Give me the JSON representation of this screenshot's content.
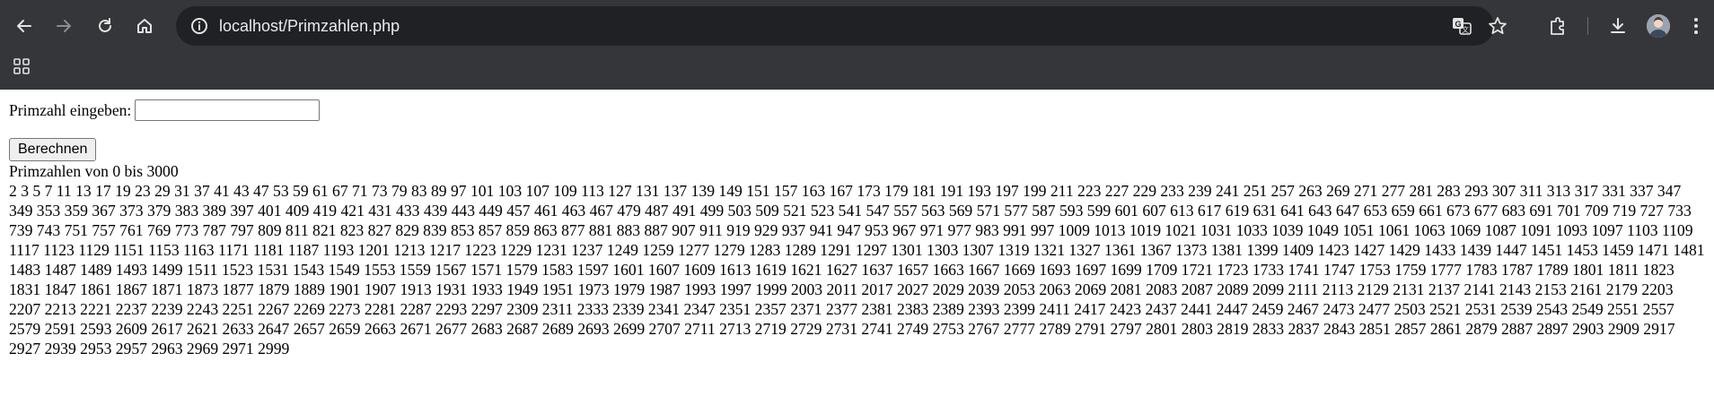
{
  "browser": {
    "url": "localhost/Primzahlen.php",
    "icons": [
      "back-icon",
      "forward-icon",
      "reload-icon",
      "home-icon",
      "site-info-icon",
      "translate-icon",
      "bookmark-star-icon",
      "extensions-icon",
      "download-icon",
      "profile-avatar",
      "menu-icon",
      "apps-icon"
    ]
  },
  "page": {
    "input_label": "Primzahl eingeben:",
    "input_value": "",
    "button_label": "Berechnen",
    "range_label": "Primzahlen von 0 bis 3000",
    "primes": "2 3 5 7 11 13 17 19 23 29 31 37 41 43 47 53 59 61 67 71 73 79 83 89 97 101 103 107 109 113 127 131 137 139 149 151 157 163 167 173 179 181 191 193 197 199 211 223 227 229 233 239 241 251 257 263 269 271 277 281 283 293 307 311 313 317 331 337 347 349 353 359 367 373 379 383 389 397 401 409 419 421 431 433 439 443 449 457 461 463 467 479 487 491 499 503 509 521 523 541 547 557 563 569 571 577 587 593 599 601 607 613 617 619 631 641 643 647 653 659 661 673 677 683 691 701 709 719 727 733 739 743 751 757 761 769 773 787 797 809 811 821 823 827 829 839 853 857 859 863 877 881 883 887 907 911 919 929 937 941 947 953 967 971 977 983 991 997 1009 1013 1019 1021 1031 1033 1039 1049 1051 1061 1063 1069 1087 1091 1093 1097 1103 1109 1117 1123 1129 1151 1153 1163 1171 1181 1187 1193 1201 1213 1217 1223 1229 1231 1237 1249 1259 1277 1279 1283 1289 1291 1297 1301 1303 1307 1319 1321 1327 1361 1367 1373 1381 1399 1409 1423 1427 1429 1433 1439 1447 1451 1453 1459 1471 1481 1483 1487 1489 1493 1499 1511 1523 1531 1543 1549 1553 1559 1567 1571 1579 1583 1597 1601 1607 1609 1613 1619 1621 1627 1637 1657 1663 1667 1669 1693 1697 1699 1709 1721 1723 1733 1741 1747 1753 1759 1777 1783 1787 1789 1801 1811 1823 1831 1847 1861 1867 1871 1873 1877 1879 1889 1901 1907 1913 1931 1933 1949 1951 1973 1979 1987 1993 1997 1999 2003 2011 2017 2027 2029 2039 2053 2063 2069 2081 2083 2087 2089 2099 2111 2113 2129 2131 2137 2141 2143 2153 2161 2179 2203 2207 2213 2221 2237 2239 2243 2251 2267 2269 2273 2281 2287 2293 2297 2309 2311 2333 2339 2341 2347 2351 2357 2371 2377 2381 2383 2389 2393 2399 2411 2417 2423 2437 2441 2447 2459 2467 2473 2477 2503 2521 2531 2539 2543 2549 2551 2557 2579 2591 2593 2609 2617 2621 2633 2647 2657 2659 2663 2671 2677 2683 2687 2689 2693 2699 2707 2711 2713 2719 2729 2731 2741 2749 2753 2767 2777 2789 2791 2797 2801 2803 2819 2833 2837 2843 2851 2857 2861 2879 2887 2897 2903 2909 2917 2927 2939 2953 2957 2963 2969 2971 2999"
  }
}
